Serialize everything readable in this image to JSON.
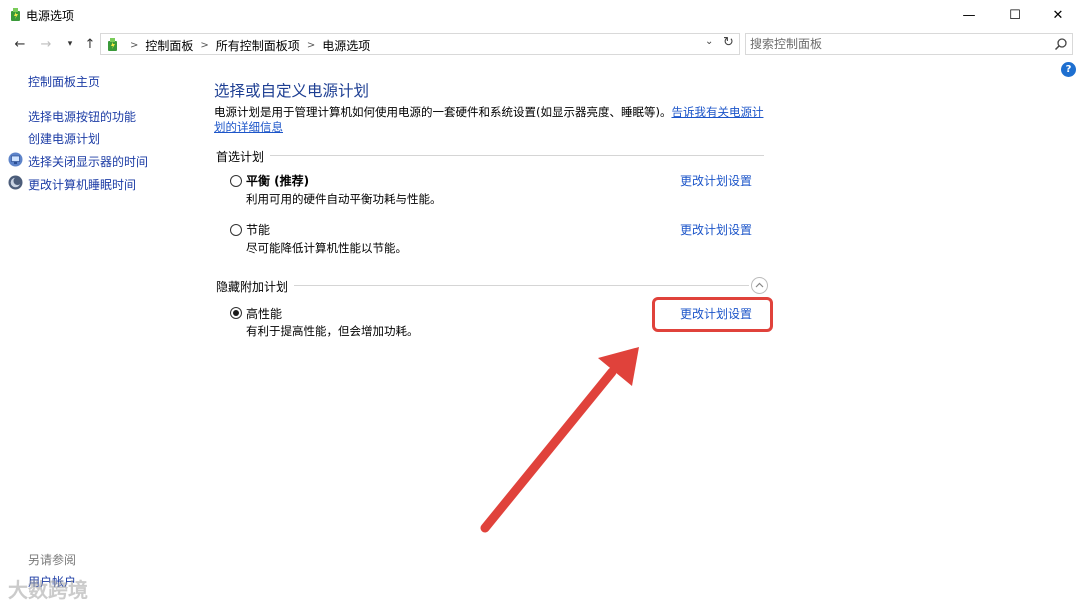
{
  "window": {
    "title": "电源选项",
    "minimize_label": "—",
    "maximize_label": "☐",
    "close_label": "✕"
  },
  "navbar": {
    "breadcrumbs": [
      "控制面板",
      "所有控制面板项",
      "电源选项"
    ],
    "search_placeholder": "搜索控制面板",
    "help_label": "?"
  },
  "sidebar": {
    "home_label": "控制面板主页",
    "items": [
      {
        "label": "选择电源按钮的功能",
        "icon": "none"
      },
      {
        "label": "创建电源计划",
        "icon": "none"
      },
      {
        "label": "选择关闭显示器的时间",
        "icon": "monitor-icon"
      },
      {
        "label": "更改计算机睡眠时间",
        "icon": "moon-icon"
      }
    ],
    "see_also_label": "另请参阅",
    "user_accounts_label": "用户帐户"
  },
  "main": {
    "title": "选择或自定义电源计划",
    "description": "电源计划是用于管理计算机如何使用电源的一套硬件和系统设置(如显示器亮度、睡眠等)。",
    "description_link": "告诉我有关电源计划的详细信息",
    "preferred_section": "首选计划",
    "hidden_section": "隐藏附加计划",
    "plans": [
      {
        "name": "平衡 (推荐)",
        "desc": "利用可用的硬件自动平衡功耗与性能。",
        "selected": false,
        "link": "更改计划设置"
      },
      {
        "name": "节能",
        "desc": "尽可能降低计算机性能以节能。",
        "selected": false,
        "link": "更改计划设置"
      },
      {
        "name": "高性能",
        "desc": "有利于提高性能，但会增加功耗。",
        "selected": true,
        "link": "更改计划设置"
      }
    ]
  },
  "annotation": {
    "highlight_color": "#e0423b",
    "watermark": "大数跨境"
  },
  "colors": {
    "link": "#1c55c9",
    "title": "#1e3f93",
    "sidebar_link": "#1c3ca5"
  }
}
